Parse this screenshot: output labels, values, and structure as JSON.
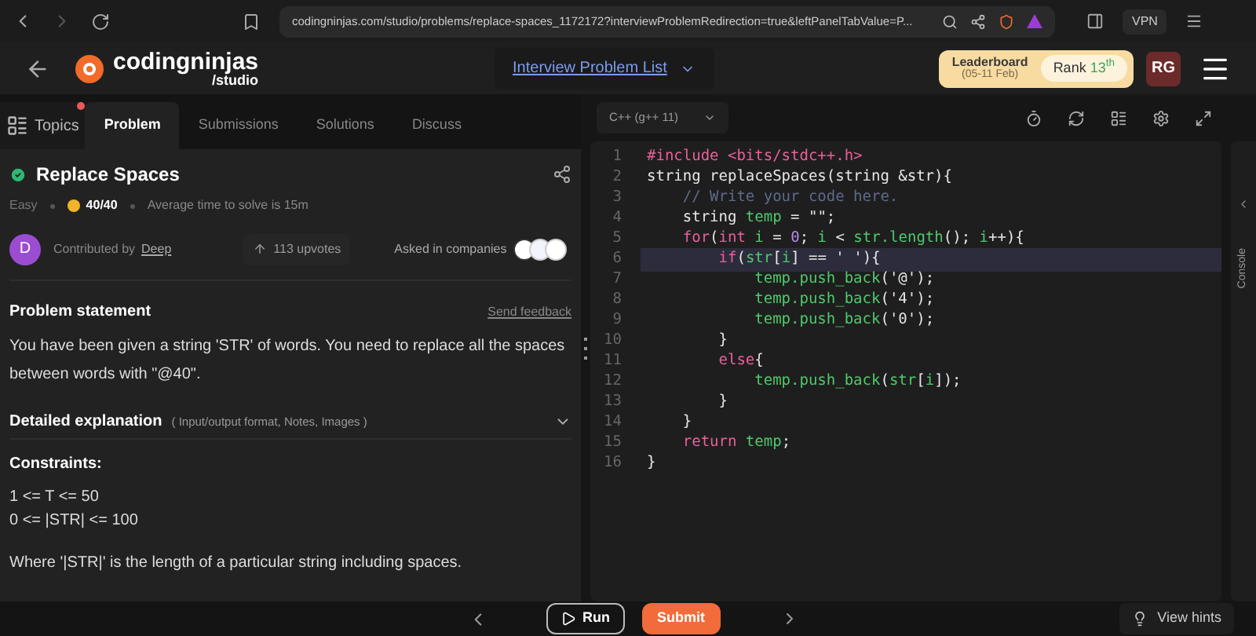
{
  "browser": {
    "url": "codingninjas.com/studio/problems/replace-spaces_1172172?interviewProblemRedirection=true&leftPanelTabValue=P...",
    "vpn": "VPN"
  },
  "header": {
    "logo_text": "codingninjas",
    "logo_sub": "/studio",
    "nav_link": "Interview Problem List",
    "leaderboard": "Leaderboard",
    "leaderboard_dates": "(05-11 Feb)",
    "rank_label": "Rank",
    "rank_value": "13",
    "rank_suffix": "th",
    "avatar": "RG"
  },
  "tabs": [
    {
      "label": "Topics",
      "kind": "topics",
      "selected": false
    },
    {
      "label": "Problem",
      "kind": "tab",
      "selected": true
    },
    {
      "label": "Submissions",
      "kind": "tab",
      "selected": false
    },
    {
      "label": "Solutions",
      "kind": "tab",
      "selected": false
    },
    {
      "label": "Discuss",
      "kind": "tab",
      "selected": false
    }
  ],
  "problem": {
    "title": "Replace Spaces",
    "solved": true,
    "difficulty": "Easy",
    "score": "40/40",
    "avg_time": "Average time to solve is 15m",
    "contributor_initial": "D",
    "contributed_by": "Contributed by",
    "contributor": "Deep",
    "upvotes": "113 upvotes",
    "asked_in": "Asked in companies",
    "statement_title": "Problem statement",
    "feedback": "Send feedback",
    "statement": "You have been given a string 'STR' of words. You need to replace all the spaces between words with \"@40\".",
    "explanation": "Detailed explanation",
    "explanation_hint": "( Input/output format, Notes, Images )",
    "constraints_title": "Constraints:",
    "constraints": [
      "1 <= T <= 50",
      "0 <= |STR| <= 100"
    ],
    "note": "Where '|STR|' is the length of a particular string including spaces."
  },
  "editor": {
    "language": "C++ (g++ 11)",
    "console": "Console",
    "lines": [
      {
        "number": "1",
        "highlighted": false,
        "tokens": [
          {
            "kind": "kw",
            "text": "#include "
          },
          {
            "kind": "str",
            "text": "<bits/stdc++.h>"
          }
        ]
      },
      {
        "number": "2",
        "highlighted": false,
        "tokens": [
          {
            "kind": "plain",
            "text": "string replaceSpaces(string &str){"
          }
        ]
      },
      {
        "number": "3",
        "highlighted": false,
        "tokens": [
          {
            "kind": "comment",
            "text": "    // Write your code here."
          }
        ]
      },
      {
        "number": "4",
        "highlighted": false,
        "tokens": [
          {
            "kind": "plain",
            "text": "    string "
          },
          {
            "kind": "ident",
            "text": "temp"
          },
          {
            "kind": "plain",
            "text": " = \"\";"
          }
        ]
      },
      {
        "number": "5",
        "highlighted": false,
        "tokens": [
          {
            "kind": "kw",
            "text": "    for"
          },
          {
            "kind": "plain",
            "text": "("
          },
          {
            "kind": "kw",
            "text": "int"
          },
          {
            "kind": "ident",
            "text": " i"
          },
          {
            "kind": "plain",
            "text": " = "
          },
          {
            "kind": "num",
            "text": "0"
          },
          {
            "kind": "plain",
            "text": "; "
          },
          {
            "kind": "ident",
            "text": "i"
          },
          {
            "kind": "plain",
            "text": " < "
          },
          {
            "kind": "ident",
            "text": "str.length"
          },
          {
            "kind": "plain",
            "text": "(); "
          },
          {
            "kind": "ident",
            "text": "i"
          },
          {
            "kind": "plain",
            "text": "++){"
          }
        ]
      },
      {
        "number": "6",
        "highlighted": true,
        "tokens": [
          {
            "kind": "kw",
            "text": "        if"
          },
          {
            "kind": "plain",
            "text": "("
          },
          {
            "kind": "ident",
            "text": "str"
          },
          {
            "kind": "plain",
            "text": "["
          },
          {
            "kind": "ident",
            "text": "i"
          },
          {
            "kind": "plain",
            "text": "] == ' '){"
          }
        ]
      },
      {
        "number": "7",
        "highlighted": false,
        "tokens": [
          {
            "kind": "ident",
            "text": "            temp.push_back"
          },
          {
            "kind": "plain",
            "text": "('@');"
          }
        ]
      },
      {
        "number": "8",
        "highlighted": false,
        "tokens": [
          {
            "kind": "ident",
            "text": "            temp.push_back"
          },
          {
            "kind": "plain",
            "text": "('4');"
          }
        ]
      },
      {
        "number": "9",
        "highlighted": false,
        "tokens": [
          {
            "kind": "ident",
            "text": "            temp.push_back"
          },
          {
            "kind": "plain",
            "text": "('0');"
          }
        ]
      },
      {
        "number": "10",
        "highlighted": false,
        "tokens": [
          {
            "kind": "plain",
            "text": "        }"
          }
        ]
      },
      {
        "number": "11",
        "highlighted": false,
        "tokens": [
          {
            "kind": "kw",
            "text": "        else"
          },
          {
            "kind": "plain",
            "text": "{"
          }
        ]
      },
      {
        "number": "12",
        "highlighted": false,
        "tokens": [
          {
            "kind": "ident",
            "text": "            temp.push_back"
          },
          {
            "kind": "plain",
            "text": "("
          },
          {
            "kind": "ident",
            "text": "str"
          },
          {
            "kind": "plain",
            "text": "["
          },
          {
            "kind": "ident",
            "text": "i"
          },
          {
            "kind": "plain",
            "text": "]);"
          }
        ]
      },
      {
        "number": "13",
        "highlighted": false,
        "tokens": [
          {
            "kind": "plain",
            "text": "        }"
          }
        ]
      },
      {
        "number": "14",
        "highlighted": false,
        "tokens": [
          {
            "kind": "plain",
            "text": "    }"
          }
        ]
      },
      {
        "number": "15",
        "highlighted": false,
        "tokens": [
          {
            "kind": "kw",
            "text": "    return "
          },
          {
            "kind": "ident",
            "text": "temp"
          },
          {
            "kind": "plain",
            "text": ";"
          }
        ]
      },
      {
        "number": "16",
        "highlighted": false,
        "tokens": [
          {
            "kind": "plain",
            "text": "}"
          }
        ]
      }
    ]
  },
  "footer": {
    "run": "Run",
    "submit": "Submit",
    "hints": "View hints"
  }
}
